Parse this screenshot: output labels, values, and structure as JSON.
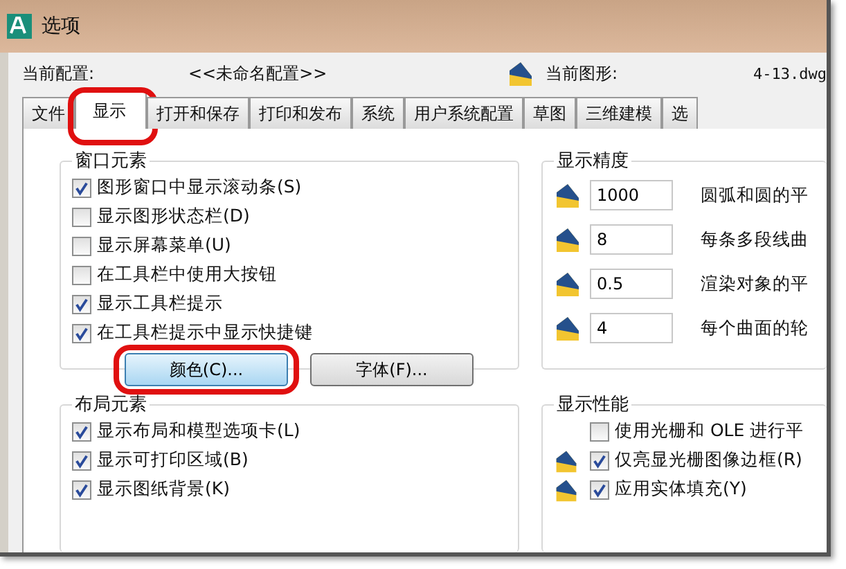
{
  "window": {
    "title": "选项"
  },
  "profile": {
    "label": "当前配置:",
    "value": "<<未命名配置>>"
  },
  "drawing": {
    "label": "当前图形:",
    "value": "4-13.dwg"
  },
  "tabs": [
    {
      "label": "文件",
      "selected": false,
      "circled": false
    },
    {
      "label": "显示",
      "selected": true,
      "circled": true
    },
    {
      "label": "打开和保存",
      "selected": false,
      "circled": false
    },
    {
      "label": "打印和发布",
      "selected": false,
      "circled": false
    },
    {
      "label": "系统",
      "selected": false,
      "circled": false
    },
    {
      "label": "用户系统配置",
      "selected": false,
      "circled": false
    },
    {
      "label": "草图",
      "selected": false,
      "circled": false
    },
    {
      "label": "三维建模",
      "selected": false,
      "circled": false
    },
    {
      "label": "选",
      "selected": false,
      "circled": false
    }
  ],
  "window_elements": {
    "title": "窗口元素",
    "options": [
      {
        "label": "图形窗口中显示滚动条(S)",
        "checked": true
      },
      {
        "label": "显示图形状态栏(D)",
        "checked": false
      },
      {
        "label": "显示屏幕菜单(U)",
        "checked": false
      },
      {
        "label": "在工具栏中使用大按钮",
        "checked": false
      },
      {
        "label": "显示工具栏提示",
        "checked": true
      },
      {
        "label": "在工具栏提示中显示快捷键",
        "checked": true
      }
    ],
    "buttons": [
      {
        "label": "颜色(C)...",
        "circled": true
      },
      {
        "label": "字体(F)...",
        "circled": false
      }
    ]
  },
  "layout_elements": {
    "title": "布局元素",
    "options": [
      {
        "label": "显示布局和模型选项卡(L)",
        "checked": true
      },
      {
        "label": "显示可打印区域(B)",
        "checked": true
      },
      {
        "label": "显示图纸背景(K)",
        "checked": true
      }
    ]
  },
  "display_resolution": {
    "title": "显示精度",
    "fields": [
      {
        "value": "1000",
        "label": "圆弧和圆的平"
      },
      {
        "value": "8",
        "label": "每条多段线曲"
      },
      {
        "value": "0.5",
        "label": "渲染对象的平"
      },
      {
        "value": "4",
        "label": "每个曲面的轮"
      }
    ]
  },
  "display_performance": {
    "title": "显示性能",
    "options": [
      {
        "label": "使用光栅和 OLE 进行平",
        "checked": false,
        "icon": false
      },
      {
        "label": "仅亮显光栅图像边框(R)",
        "checked": true,
        "icon": true
      },
      {
        "label": "应用实体填充(Y)",
        "checked": true,
        "icon": true
      }
    ]
  }
}
